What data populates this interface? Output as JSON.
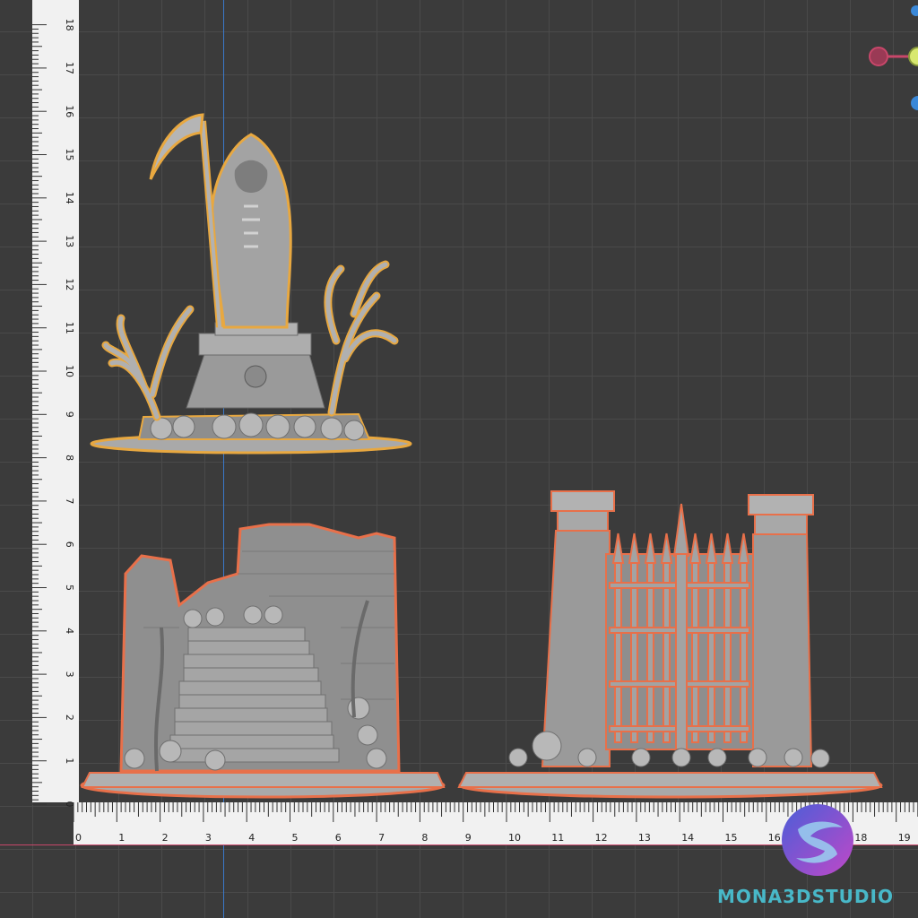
{
  "rulers": {
    "vertical_labels": [
      "0",
      "1",
      "2",
      "3",
      "4",
      "5",
      "6",
      "7",
      "8",
      "9",
      "10",
      "11",
      "12",
      "13",
      "14",
      "15",
      "16",
      "17",
      "18"
    ],
    "horizontal_labels": [
      "0",
      "1",
      "2",
      "3",
      "4",
      "5",
      "6",
      "7",
      "8",
      "9",
      "10",
      "11",
      "12",
      "13",
      "14",
      "15",
      "16",
      "17",
      "18",
      "19"
    ]
  },
  "gizmo": {
    "axes": [
      {
        "name": "x-axis-handle",
        "color": "#c8476a"
      },
      {
        "name": "y-axis-handle",
        "color": "#c8d84a"
      },
      {
        "name": "z-axis-handle",
        "color": "#3a88d8"
      }
    ]
  },
  "models": [
    {
      "name": "grim-reaper-statue",
      "outline_color": "#e8a840"
    },
    {
      "name": "ruined-staircase",
      "outline_color": "#e8704a"
    },
    {
      "name": "graveyard-gate",
      "outline_color": "#e86040"
    }
  ],
  "colors": {
    "accent_red_line": "#c8476a",
    "accent_blue_line": "#3a78c8",
    "model_fill": "#a7a7a7",
    "watermark": "#48b8c8"
  },
  "watermark": {
    "text": "MONA3DSTUDIO"
  }
}
